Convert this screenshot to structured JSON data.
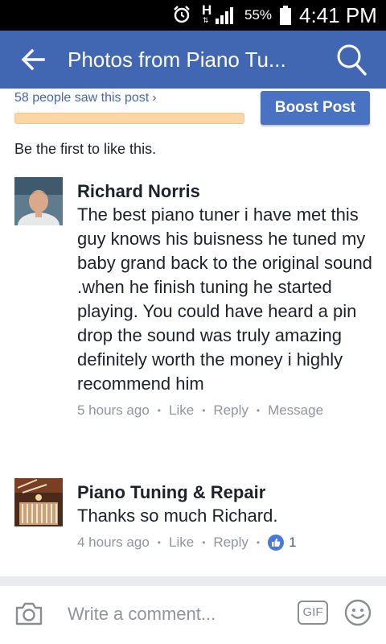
{
  "status_bar": {
    "network": "H",
    "network_arrows": "⇅",
    "battery_percent": "55%",
    "time": "4:41 PM"
  },
  "header": {
    "back_icon": "back-arrow-icon",
    "title": "Photos from Piano Tu...",
    "search_icon": "search-icon"
  },
  "reach": {
    "text": "58 people saw this post",
    "chevron": "›",
    "boost_label": "Boost Post"
  },
  "likes_summary": "Be the first to like this.",
  "comments": [
    {
      "author": "Richard Norris",
      "text": "The best piano tuner i have met this guy knows his buisness he tuned my baby grand back to the original sound  .when he finish tuning he started playing. You could have heard a pin drop  the sound was truly amazing definitely worth the money i highly recommend him",
      "time": "5 hours ago",
      "actions": [
        "Like",
        "Reply",
        "Message"
      ]
    },
    {
      "author": "Piano Tuning & Repair",
      "text": "Thanks so much Richard.",
      "time": "4 hours ago",
      "actions": [
        "Like",
        "Reply"
      ],
      "reaction_count": "1"
    }
  ],
  "composer": {
    "placeholder": "Write a comment...",
    "gif_label": "GIF"
  },
  "colors": {
    "brand": "#4267b2",
    "boost": "#4a72c2",
    "reach_bar": "#fdd6a6",
    "meta_text": "#90949c",
    "like_badge": "#4a78d8"
  }
}
